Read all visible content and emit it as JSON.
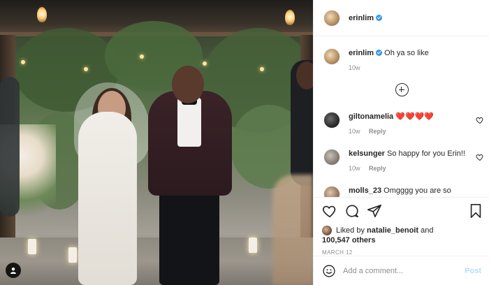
{
  "post": {
    "author": "erinlim",
    "verified": true
  },
  "caption": {
    "username": "erinlim",
    "text": "Oh ya so like",
    "age": "10w"
  },
  "comments": [
    {
      "username": "giltonamelia",
      "text": "❤️❤️❤️❤️",
      "age": "10w",
      "reply_label": "Reply"
    },
    {
      "username": "kelsunger",
      "text": "So happy for you Erin!!",
      "age": "10w",
      "reply_label": "Reply"
    },
    {
      "username": "molls_23",
      "text": "Omgggg you are so"
    }
  ],
  "engagement": {
    "liked_by_prefix": "Liked by",
    "liked_by_user": "natalie_benoit",
    "liked_by_suffix": "and",
    "others": "100,547 others",
    "date": "MARCH 12"
  },
  "comment_box": {
    "placeholder": "Add a comment...",
    "post_label": "Post"
  },
  "colors": {
    "verified": "#3897f0",
    "post_button": "#b2dffc",
    "heart_emoji": "#e0245e"
  },
  "icons": {
    "like": "heart-icon",
    "comment": "comment-icon",
    "share": "paper-plane-icon",
    "save": "bookmark-icon",
    "emoji": "smiley-icon",
    "load_more": "plus-circle-icon",
    "tagged_users": "user-icon"
  }
}
